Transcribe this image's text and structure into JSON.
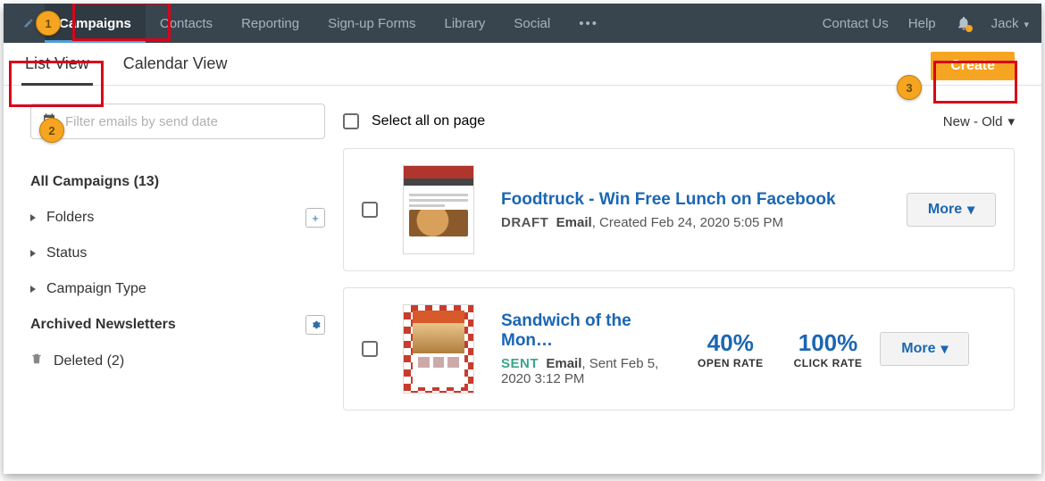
{
  "nav": {
    "items": [
      "Campaigns",
      "Contacts",
      "Reporting",
      "Sign-up Forms",
      "Library",
      "Social"
    ],
    "active_index": 0,
    "contact_us": "Contact Us",
    "help": "Help",
    "user_name": "Jack"
  },
  "view_tabs": {
    "list": "List View",
    "calendar": "Calendar View",
    "active": "list"
  },
  "create_label": "Create",
  "filter": {
    "placeholder": "Filter emails by send date"
  },
  "sidebar": {
    "all_label": "All Campaigns (13)",
    "folders": "Folders",
    "status": "Status",
    "campaign_type": "Campaign Type",
    "archived": "Archived Newsletters",
    "deleted": "Deleted (2)"
  },
  "list": {
    "select_all": "Select all on page",
    "sort_label": "New - Old",
    "more_label": "More",
    "items": [
      {
        "title": "Foodtruck - Win Free Lunch on Facebook",
        "status": "DRAFT",
        "status_class": "",
        "type": "Email",
        "meta_suffix": ", Created Feb 24, 2020 5:05 PM",
        "stats": null
      },
      {
        "title": "Sandwich of the Mon…",
        "status": "SENT",
        "status_class": "sent",
        "type": "Email",
        "meta_suffix": ", Sent Feb 5, 2020 3:12 PM",
        "stats": {
          "open": "40%",
          "open_label": "OPEN RATE",
          "click": "100%",
          "click_label": "CLICK RATE"
        }
      }
    ]
  },
  "callouts": {
    "n1": "1",
    "n2": "2",
    "n3": "3"
  }
}
